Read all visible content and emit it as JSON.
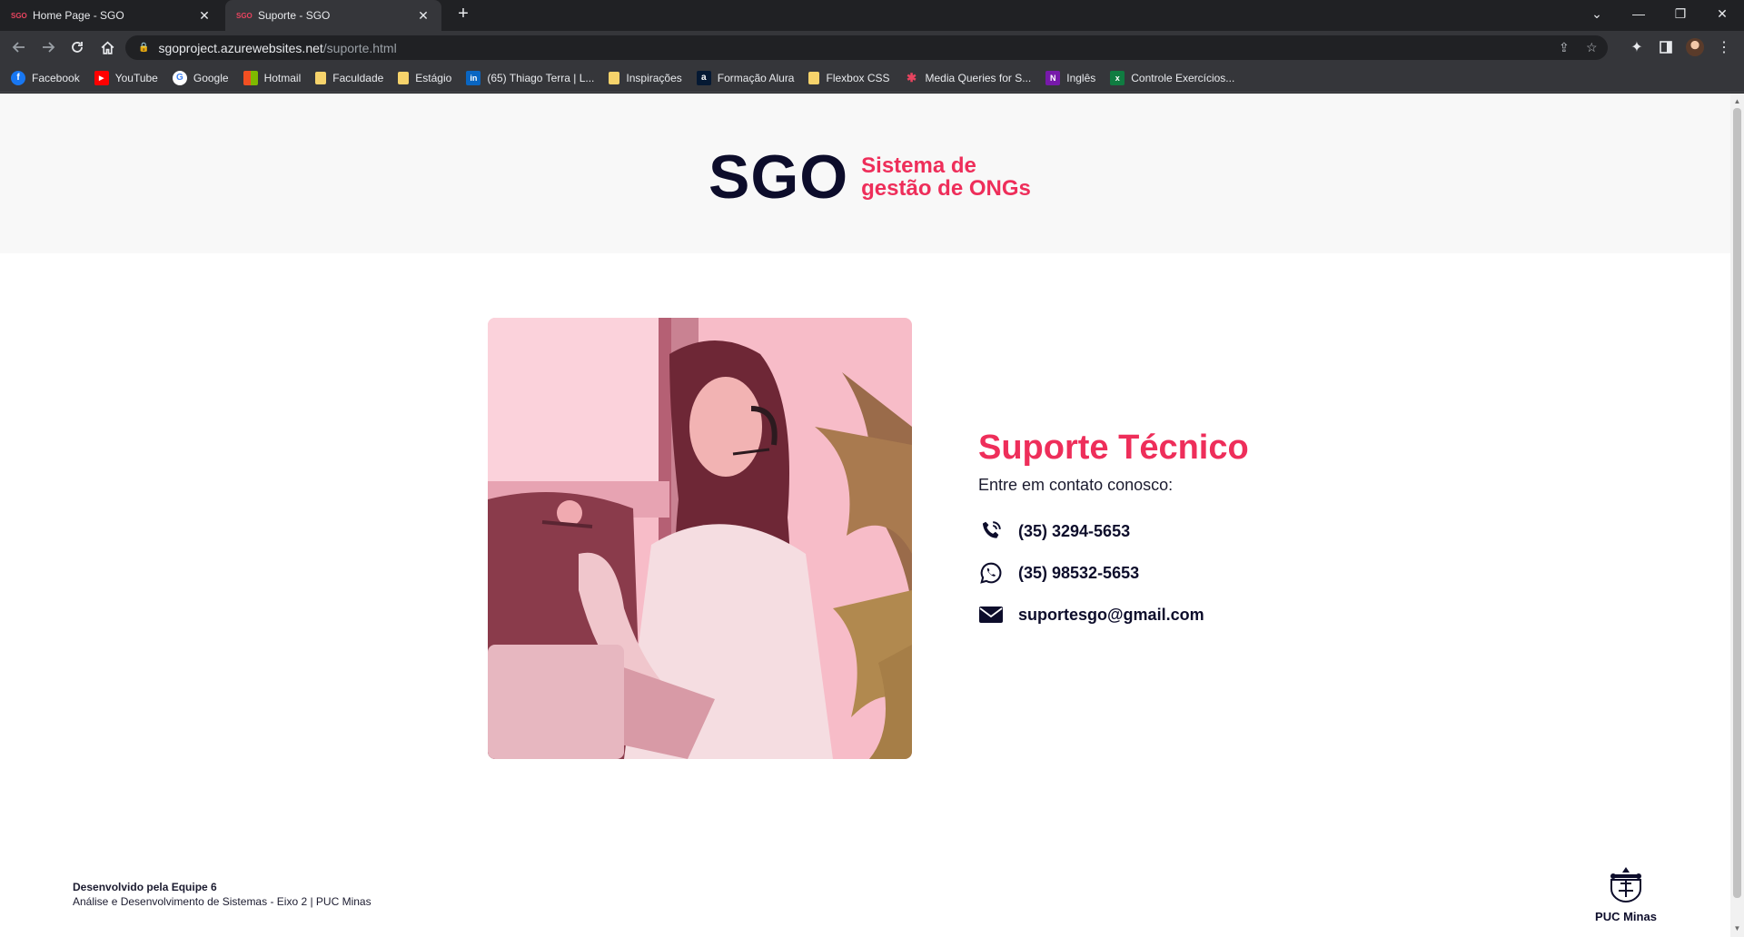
{
  "browser": {
    "tabs": [
      {
        "favicon": "SGO",
        "title": "Home Page - SGO",
        "active": false
      },
      {
        "favicon": "SGO",
        "title": "Suporte - SGO",
        "active": true
      }
    ],
    "new_tab_label": "+",
    "address": {
      "host": "sgoproject.azurewebsites.net",
      "path": "/suporte.html"
    },
    "bookmarks": [
      {
        "label": "Facebook",
        "icon": "facebook-icon",
        "color": "#1877f2",
        "glyph": "f"
      },
      {
        "label": "YouTube",
        "icon": "youtube-icon",
        "color": "#ff0000",
        "glyph": "▶"
      },
      {
        "label": "Google",
        "icon": "google-icon",
        "color": "#ffffff",
        "glyph": "G"
      },
      {
        "label": "Hotmail",
        "icon": "microsoft-icon",
        "color": "#f25022",
        "glyph": "■"
      },
      {
        "label": "Faculdade",
        "icon": "folder-icon",
        "color": "#f6d36b",
        "glyph": ""
      },
      {
        "label": "Estágio",
        "icon": "folder-icon",
        "color": "#f6d36b",
        "glyph": ""
      },
      {
        "label": "(65) Thiago Terra | L...",
        "icon": "linkedin-icon",
        "color": "#0a66c2",
        "glyph": "in"
      },
      {
        "label": "Inspirações",
        "icon": "folder-icon",
        "color": "#f6d36b",
        "glyph": ""
      },
      {
        "label": "Formação Alura",
        "icon": "alura-icon",
        "color": "#051933",
        "glyph": "a"
      },
      {
        "label": "Flexbox CSS",
        "icon": "folder-icon",
        "color": "#f6d36b",
        "glyph": ""
      },
      {
        "label": "Media Queries for S...",
        "icon": "asterisk-icon",
        "color": "#e8445f",
        "glyph": "✱"
      },
      {
        "label": "Inglês",
        "icon": "onenote-icon",
        "color": "#7719aa",
        "glyph": "N"
      },
      {
        "label": "Controle Exercícios...",
        "icon": "excel-icon",
        "color": "#107c41",
        "glyph": "x"
      }
    ]
  },
  "page": {
    "header": {
      "logo_mark": "SGO",
      "logo_sub_line1": "Sistema de",
      "logo_sub_line2": "gestão de ONGs"
    },
    "support": {
      "title": "Suporte Técnico",
      "subtitle": "Entre em contato conosco:",
      "contacts": [
        {
          "icon": "phone-icon",
          "value": "(35) 3294-5653"
        },
        {
          "icon": "whatsapp-icon",
          "value": "(35) 98532-5653"
        },
        {
          "icon": "mail-icon",
          "value": "suportesgo@gmail.com"
        }
      ]
    },
    "footer": {
      "line1": "Desenvolvido pela Equipe 6",
      "line2": "Análise e Desenvolvimento de Sistemas - Eixo 2 | PUC Minas",
      "brand": "PUC Minas"
    }
  },
  "colors": {
    "accent": "#ee2e5a",
    "navy": "#0d0d2b",
    "header_bg": "#f8f8f8"
  }
}
